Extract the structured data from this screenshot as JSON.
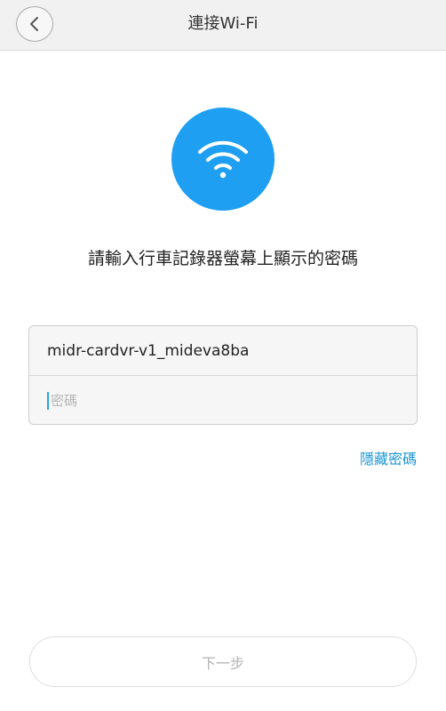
{
  "header": {
    "title": "連接Wi-Fi",
    "back_icon": "chevron-left-icon"
  },
  "wifi_badge": {
    "icon": "wifi-icon",
    "color": "#1e9ff2"
  },
  "instruction": "請輸入行車記錄器螢幕上顯示的密碼",
  "form": {
    "ssid_value": "midr-cardvr-v1_mideva8ba",
    "password_placeholder": "密碼",
    "password_value": ""
  },
  "hide_password_label": "隱藏密碼",
  "next_button_label": "下一步",
  "colors": {
    "accent": "#1b95d6",
    "header_bg": "#f1f1f1",
    "disabled_text": "#b3b3b3"
  }
}
